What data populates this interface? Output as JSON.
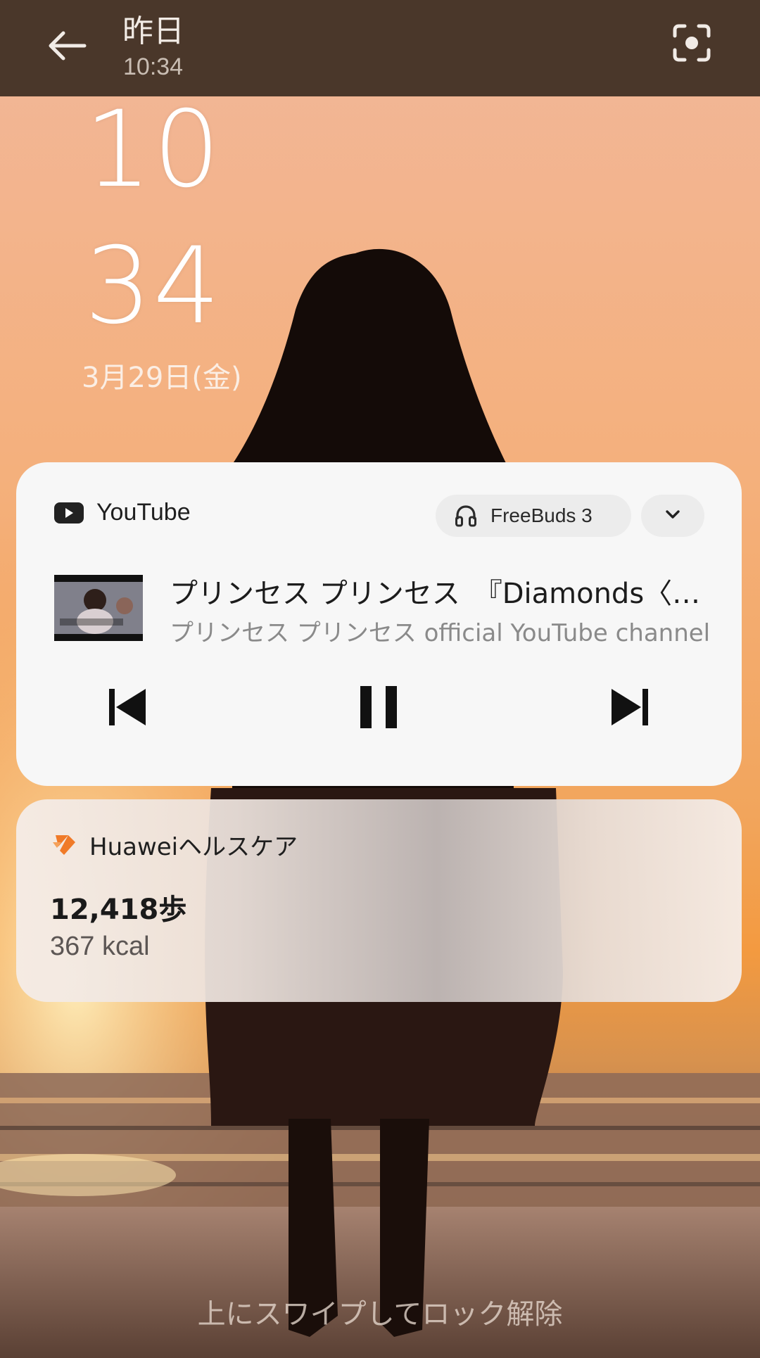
{
  "header": {
    "title": "昨日",
    "subtitle": "10:34",
    "back_icon": "arrow-left-icon",
    "scan_icon": "screen-scan-icon"
  },
  "lock_clock": {
    "hour": "10",
    "minute": "34",
    "date": "3月29日(金)"
  },
  "media": {
    "app_name": "YouTube",
    "device_name": "FreeBuds 3",
    "title": "プリンセス プリンセス　『Diamonds〈ダイアモンド〉』",
    "artist": "プリンセス プリンセス official YouTube channel",
    "controls": [
      "skip-previous-icon",
      "pause-icon",
      "skip-next-icon"
    ],
    "is_playing": true
  },
  "health": {
    "app_name": "Huaweiヘルスケア",
    "steps": "12,418歩",
    "calories": "367 kcal",
    "accent_color": "#f07a28"
  },
  "lock_hint": "上にスワイプしてロック解除",
  "colors": {
    "topbar_bg": "#4a372a",
    "card_bg": "#f7f7f7"
  }
}
